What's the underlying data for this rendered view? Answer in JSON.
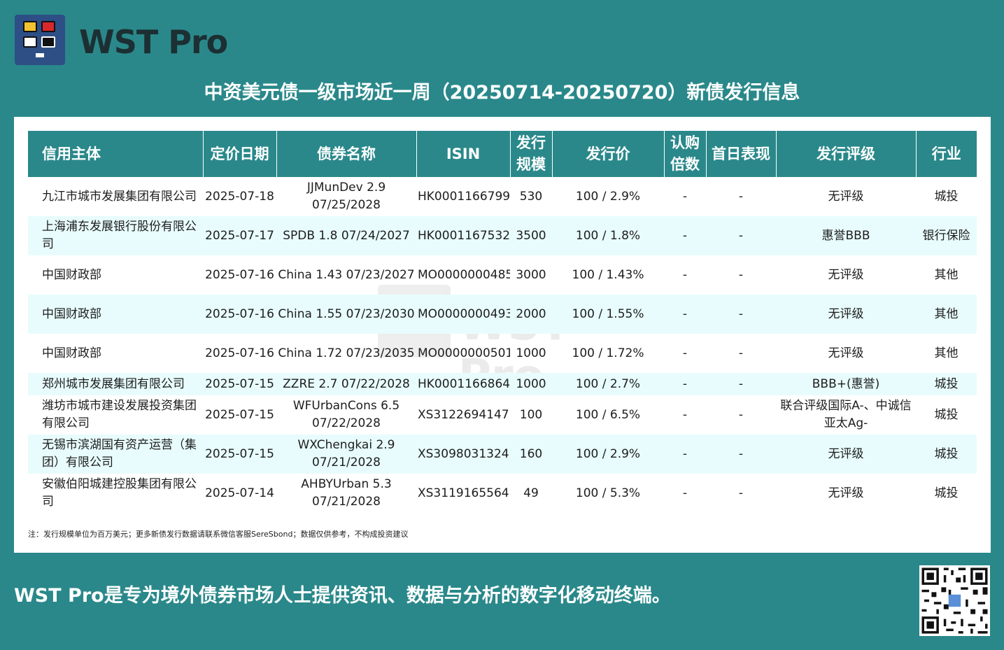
{
  "brand": {
    "name": "WST Pro"
  },
  "title": "中资美元债一级市场近一周（20250714-20250720）新债发行信息",
  "table": {
    "headers": [
      "信用主体",
      "定价日期",
      "债券名称",
      "ISIN",
      "发行规模",
      "发行价",
      "认购倍数",
      "首日表现",
      "发行评级",
      "行业"
    ],
    "rows": [
      {
        "issuer": "九江市城市发展集团有限公司",
        "date": "2025-07-18",
        "bond": "JJMunDev 2.9 07/25/2028",
        "isin": "HK0001166799",
        "size": "530",
        "price": "100 / 2.9%",
        "sub": "-",
        "first_day": "-",
        "rating": "无评级",
        "industry": "城投"
      },
      {
        "issuer": "上海浦东发展银行股份有限公司",
        "date": "2025-07-17",
        "bond": "SPDB 1.8 07/24/2027",
        "isin": "HK0001167532",
        "size": "3500",
        "price": "100 / 1.8%",
        "sub": "-",
        "first_day": "-",
        "rating": "惠誉BBB",
        "industry": "银行保险"
      },
      {
        "issuer": "中国财政部",
        "date": "2025-07-16",
        "bond": "China 1.43 07/23/2027",
        "isin": "MO0000000485",
        "size": "3000",
        "price": "100 / 1.43%",
        "sub": "-",
        "first_day": "-",
        "rating": "无评级",
        "industry": "其他"
      },
      {
        "issuer": "中国财政部",
        "date": "2025-07-16",
        "bond": "China 1.55 07/23/2030",
        "isin": "MO0000000493",
        "size": "2000",
        "price": "100 / 1.55%",
        "sub": "-",
        "first_day": "-",
        "rating": "无评级",
        "industry": "其他"
      },
      {
        "issuer": "中国财政部",
        "date": "2025-07-16",
        "bond": "China 1.72 07/23/2035",
        "isin": "MO0000000501",
        "size": "1000",
        "price": "100 / 1.72%",
        "sub": "-",
        "first_day": "-",
        "rating": "无评级",
        "industry": "其他"
      },
      {
        "issuer": "郑州城市发展集团有限公司",
        "date": "2025-07-15",
        "bond": "ZZRE 2.7 07/22/2028",
        "isin": "HK0001166864",
        "size": "1000",
        "price": "100 / 2.7%",
        "sub": "-",
        "first_day": "-",
        "rating": "BBB+(惠誉)",
        "industry": "城投"
      },
      {
        "issuer": "潍坊市城市建设发展投资集团有限公司",
        "date": "2025-07-15",
        "bond": "WFUrbanCons 6.5 07/22/2028",
        "isin": "XS3122694147",
        "size": "100",
        "price": "100 / 6.5%",
        "sub": "-",
        "first_day": "-",
        "rating": "联合评级国际A-、中诚信亚太Ag-",
        "industry": "城投"
      },
      {
        "issuer": "无锡市滨湖国有资产运营（集团）有限公司",
        "date": "2025-07-15",
        "bond": "WXChengkai 2.9 07/21/2028",
        "isin": "XS3098031324",
        "size": "160",
        "price": "100 / 2.9%",
        "sub": "-",
        "first_day": "-",
        "rating": "无评级",
        "industry": "城投"
      },
      {
        "issuer": "安徽伯阳城建控股集团有限公司",
        "date": "2025-07-14",
        "bond": "AHBYUrban 5.3 07/21/2028",
        "isin": "XS3119165564",
        "size": "49",
        "price": "100 / 5.3%",
        "sub": "-",
        "first_day": "-",
        "rating": "无评级",
        "industry": "城投"
      }
    ]
  },
  "note": "注：发行规模单位为百万美元；更多新债发行数据请联系微信客服SereSbond；数据仅供参考，不构成投资建议",
  "watermark": "WST Pro",
  "tagline": "WST Pro是专为境外债券市场人士提供资讯、数据与分析的数字化移动终端。",
  "colors": {
    "background": "#2a888a",
    "logo_bg": "#2d4f86",
    "row_alt": "#e8fcfd"
  }
}
